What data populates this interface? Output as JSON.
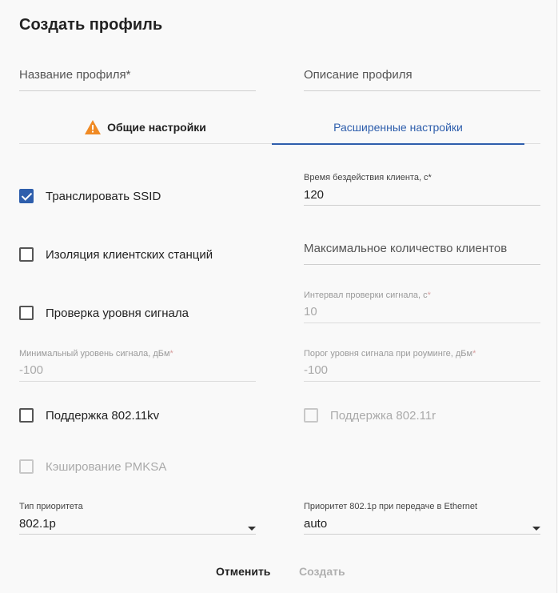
{
  "dialog": {
    "title": "Создать профиль",
    "profile_name_placeholder": "Название профиля*",
    "profile_description_placeholder": "Описание профиля"
  },
  "tabs": {
    "general": "Общие настройки",
    "advanced": "Расширенные настройки",
    "active": "advanced"
  },
  "fields": {
    "idle_time": {
      "label": "Время бездействия клиента, с*",
      "value": "120"
    },
    "max_clients": {
      "placeholder": "Максимальное количество клиентов"
    },
    "signal_check_interval": {
      "label": "Интервал проверки сигнала, с",
      "req": "*",
      "value": "10"
    },
    "min_signal": {
      "label": "Минимальный уровень сигнала, дБм",
      "req": "*",
      "value": "-100"
    },
    "roaming_threshold": {
      "label": "Порог уровня сигнала при роуминге, дБм",
      "req": "*",
      "value": "-100"
    },
    "priority_type": {
      "label": "Тип приоритета",
      "value": "802.1p"
    },
    "priority_ethernet": {
      "label": "Приоритет 802.1p при передаче в Ethernet",
      "value": "auto"
    }
  },
  "checkboxes": {
    "broadcast_ssid": {
      "label": "Транслировать SSID",
      "checked": true
    },
    "client_isolation": {
      "label": "Изоляция клиентских станций",
      "checked": false
    },
    "signal_check": {
      "label": "Проверка уровня сигнала",
      "checked": false
    },
    "support_80211kv": {
      "label": "Поддержка 802.11kv",
      "checked": false
    },
    "support_80211r": {
      "label": "Поддержка 802.11r",
      "checked": false,
      "disabled": true
    },
    "pmksa_caching": {
      "label": "Кэширование PMKSA",
      "checked": false,
      "disabled": true
    }
  },
  "actions": {
    "cancel": "Отменить",
    "create": "Создать"
  },
  "colors": {
    "accent": "#2e5eac",
    "warning": "#f08a24"
  }
}
